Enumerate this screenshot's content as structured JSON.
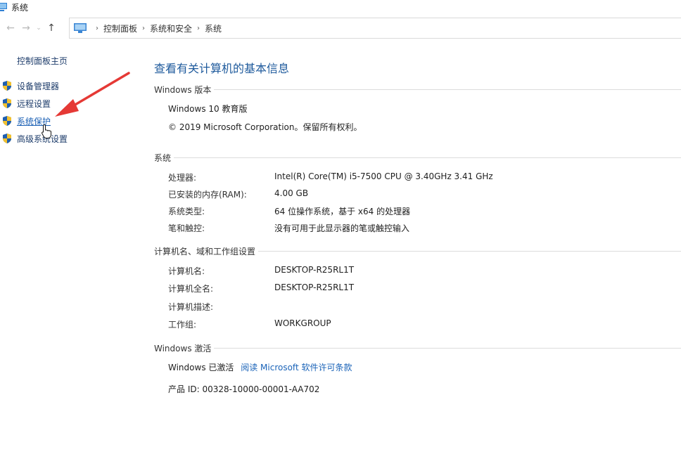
{
  "window": {
    "title": "系统"
  },
  "address": {
    "back_glyph": "←",
    "forward_glyph": "→",
    "history_glyph": "⌄",
    "up_glyph": "↑",
    "crumbs": [
      "控制面板",
      "系统和安全",
      "系统"
    ],
    "sep": "›"
  },
  "sidebar": {
    "home": "控制面板主页",
    "items": [
      {
        "label": "设备管理器",
        "icon": "uac-shield-icon"
      },
      {
        "label": "远程设置",
        "icon": "uac-shield-icon"
      },
      {
        "label": "系统保护",
        "icon": "uac-shield-icon"
      },
      {
        "label": "高级系统设置",
        "icon": "uac-shield-icon"
      }
    ]
  },
  "main": {
    "heading": "查看有关计算机的基本信息",
    "edition": {
      "section": "Windows 版本",
      "name": "Windows 10 教育版",
      "copyright": "© 2019 Microsoft Corporation。保留所有权利。"
    },
    "system": {
      "section": "系统",
      "rows": [
        {
          "label": "处理器:",
          "value": "Intel(R) Core(TM) i5-7500 CPU @ 3.40GHz   3.41 GHz"
        },
        {
          "label": "已安装的内存(RAM):",
          "value": "4.00 GB"
        },
        {
          "label": "系统类型:",
          "value": "64 位操作系统，基于 x64 的处理器"
        },
        {
          "label": "笔和触控:",
          "value": "没有可用于此显示器的笔或触控输入"
        }
      ]
    },
    "computer": {
      "section": "计算机名、域和工作组设置",
      "rows": [
        {
          "label": "计算机名:",
          "value": "DESKTOP-R25RL1T"
        },
        {
          "label": "计算机全名:",
          "value": "DESKTOP-R25RL1T"
        },
        {
          "label": "计算机描述:",
          "value": ""
        },
        {
          "label": "工作组:",
          "value": "WORKGROUP"
        }
      ]
    },
    "activation": {
      "section": "Windows 激活",
      "status": "Windows 已激活",
      "link": "阅读 Microsoft 软件许可条款",
      "product_id": "产品 ID: 00328-10000-00001-AA702"
    }
  },
  "colors": {
    "arrow": "#e53935",
    "link": "#1a63b8",
    "heading": "#1e5a9c"
  }
}
